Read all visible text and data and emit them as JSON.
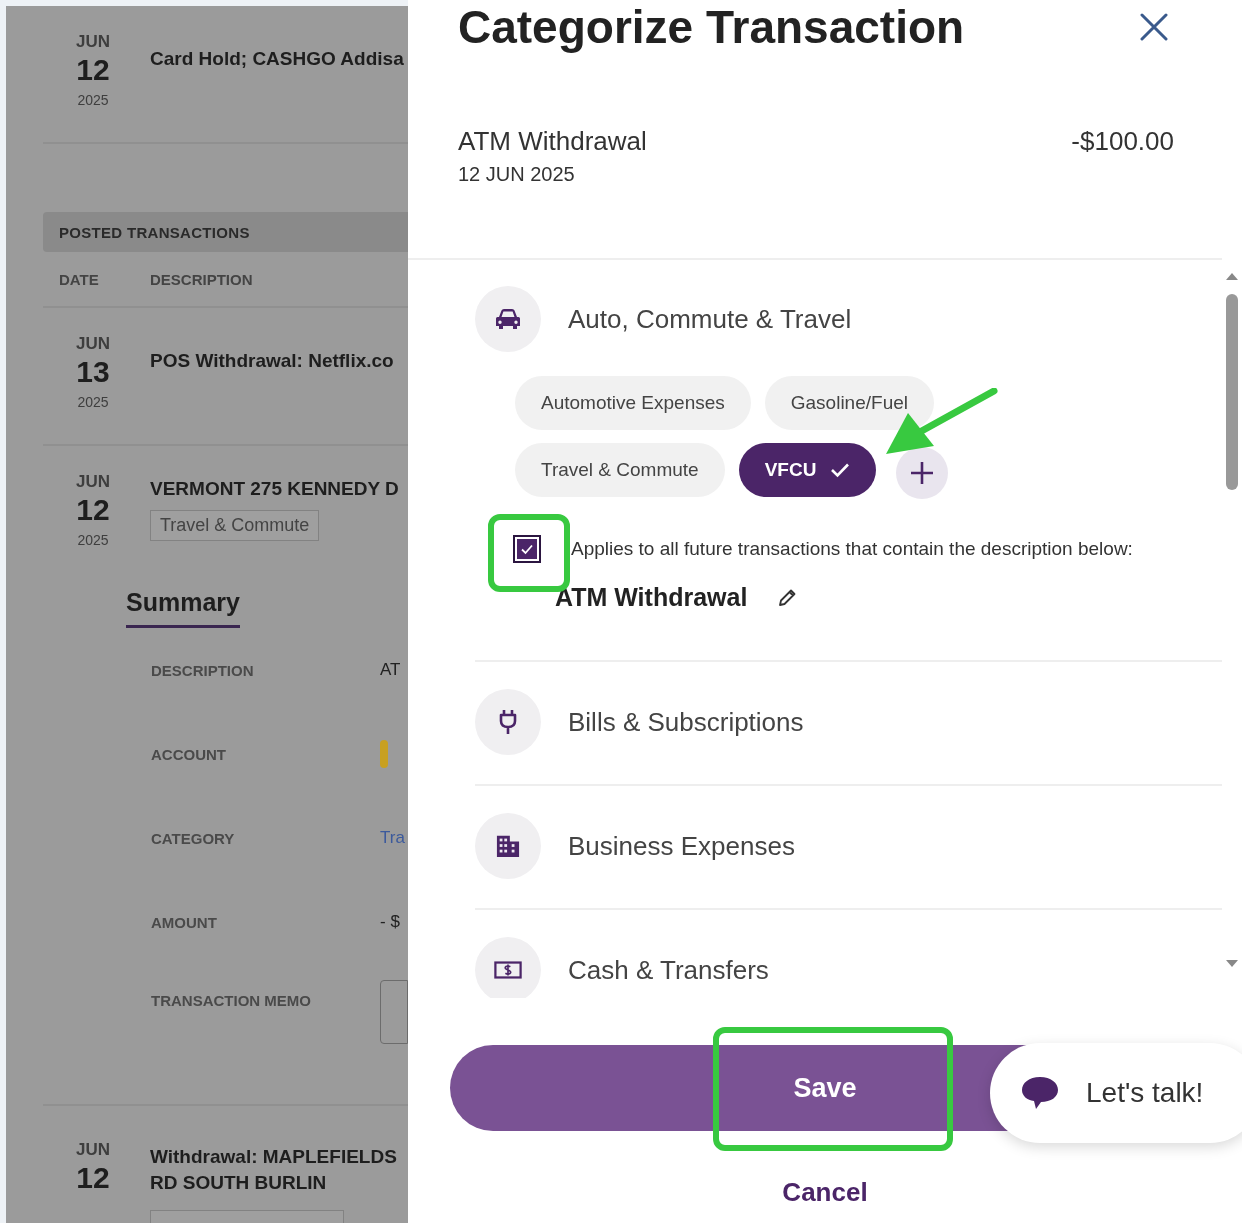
{
  "background_page": {
    "pending_rows": [
      {
        "month": "JUN",
        "day": "12",
        "year": "2025",
        "description": "Card Hold; CASHGO Addisa"
      }
    ],
    "posted_section": {
      "title": "POSTED TRANSACTIONS",
      "columns": [
        "DATE",
        "DESCRIPTION"
      ]
    },
    "posted_rows": [
      {
        "month": "JUN",
        "day": "13",
        "year": "2025",
        "description": "POS Withdrawal: Netflix.co"
      },
      {
        "month": "JUN",
        "day": "12",
        "year": "2025",
        "description": "VERMONT 275 KENNEDY D",
        "tag": "Travel & Commute"
      }
    ],
    "summary": {
      "tab": "Summary",
      "fields": [
        {
          "label": "DESCRIPTION",
          "kind": "text",
          "value": "AT"
        },
        {
          "label": "ACCOUNT",
          "kind": "account-bar"
        },
        {
          "label": "CATEGORY",
          "kind": "link",
          "value": "Tra"
        },
        {
          "label": "AMOUNT",
          "kind": "text",
          "value": "- $"
        },
        {
          "label": "TRANSACTION MEMO",
          "kind": "field"
        }
      ]
    },
    "later_rows": [
      {
        "month": "JUN",
        "day": "12",
        "description_lines": [
          "Withdrawal: MAPLEFIELDS",
          "RD SOUTH BURLIN"
        ]
      }
    ]
  },
  "dialog": {
    "title": "Categorize Transaction",
    "transaction": {
      "name": "ATM Withdrawal",
      "date": "12 JUN 2025",
      "amount": "-$100.00"
    },
    "categories": [
      {
        "name": "Auto, Commute & Travel",
        "expanded": true,
        "subcategories": [
          {
            "label": "Automotive Expenses",
            "selected": false
          },
          {
            "label": "Gasoline/Fuel",
            "selected": false
          },
          {
            "label": "Travel & Commute",
            "selected": false
          },
          {
            "label": "VFCU",
            "selected": true
          }
        ],
        "rule": {
          "checked": true,
          "text": "Applies to all future transactions that contain the description below:",
          "description": "ATM Withdrawal"
        }
      },
      {
        "name": "Bills & Subscriptions",
        "expanded": false
      },
      {
        "name": "Business Expenses",
        "expanded": false
      },
      {
        "name": "Cash & Transfers",
        "expanded": false
      }
    ],
    "save": "Save",
    "cancel": "Cancel"
  },
  "chat": {
    "label": "Let's talk!"
  }
}
